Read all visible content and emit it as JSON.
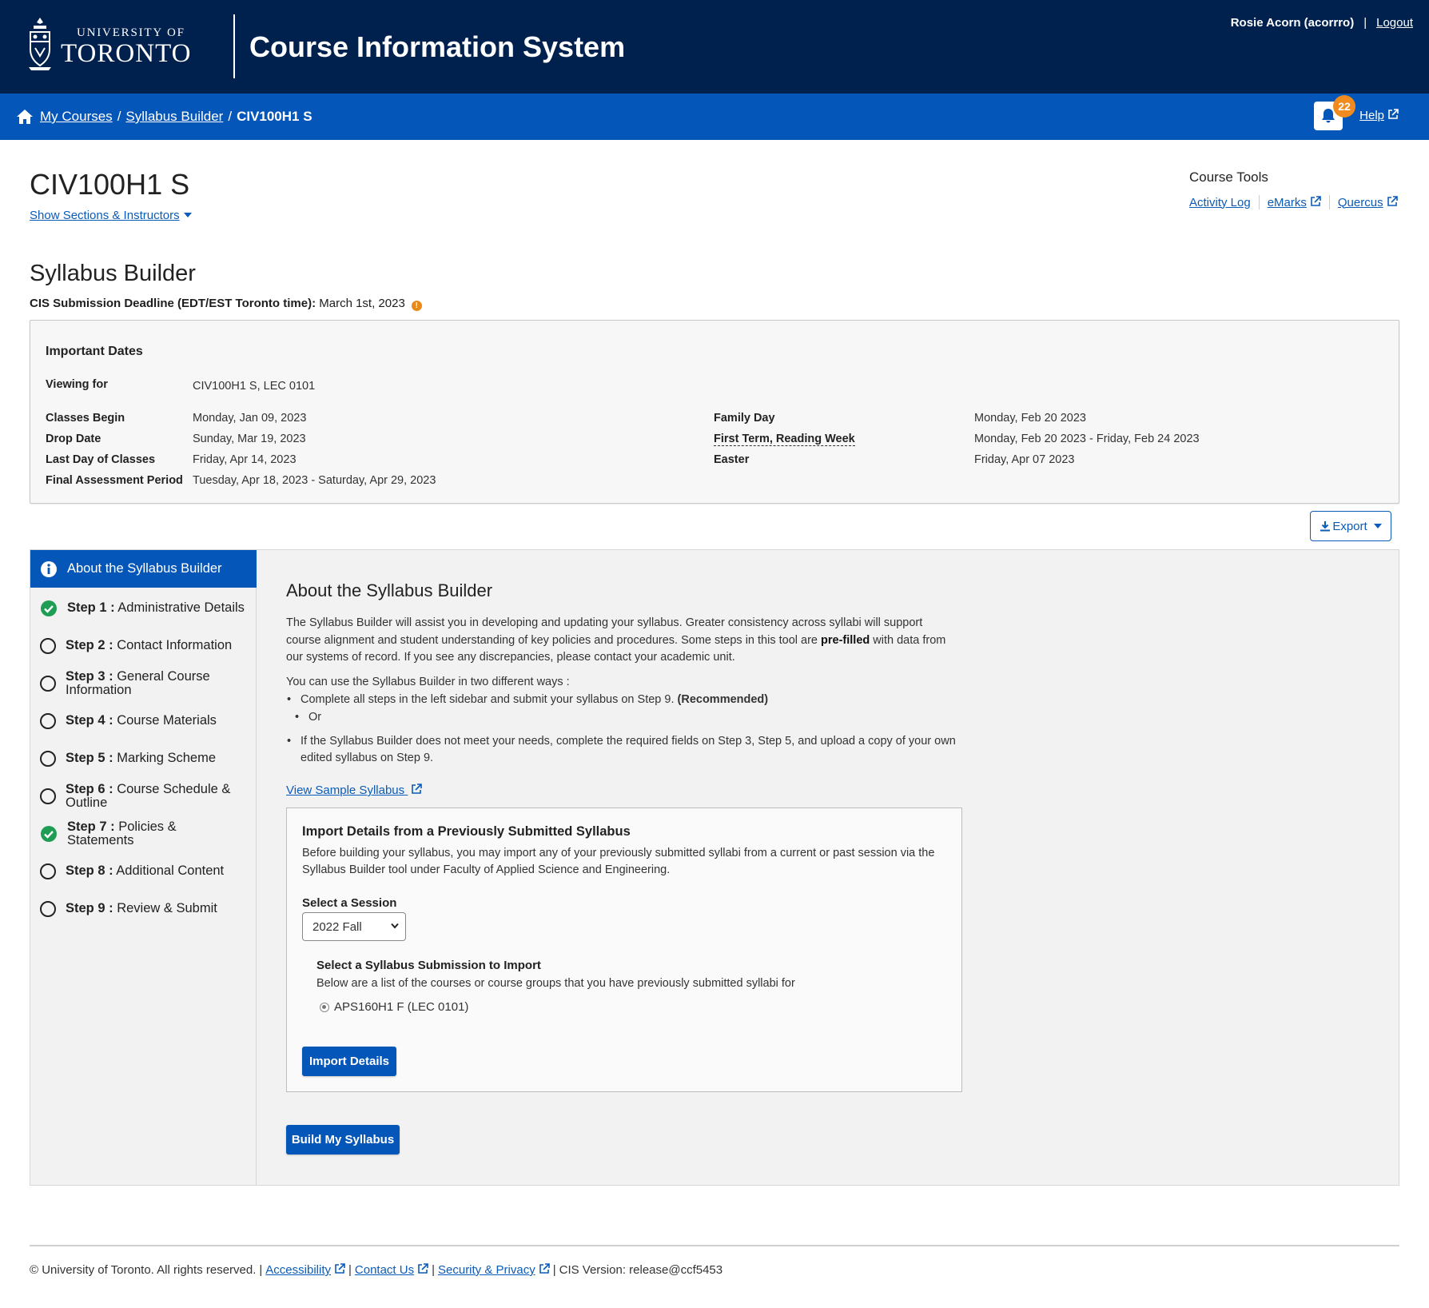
{
  "header": {
    "logo_university_of": "UNIVERSITY OF",
    "logo_toronto": "TORONTO",
    "app_title": "Course Information System",
    "user": "Rosie Acorn (acorrro)",
    "logout": "Logout"
  },
  "nav": {
    "breadcrumbs": [
      "My Courses",
      "Syllabus Builder",
      "CIV100H1 S"
    ],
    "notification_count": "22",
    "help": "Help"
  },
  "course": {
    "code": "CIV100H1 S",
    "show_sections": "Show Sections & Instructors"
  },
  "course_tools": {
    "title": "Course Tools",
    "links": [
      "Activity Log",
      "eMarks",
      "Quercus"
    ]
  },
  "syllabus_builder": {
    "title": "Syllabus Builder",
    "deadline_label": "CIS Submission Deadline (EDT/EST Toronto time):",
    "deadline_value": "March 1st, 2023"
  },
  "important_dates": {
    "title": "Important Dates",
    "viewing_for_label": "Viewing for",
    "viewing_for_value": "CIV100H1 S, LEC 0101",
    "left": [
      {
        "label": "Classes Begin",
        "value": "Monday, Jan 09, 2023"
      },
      {
        "label": "Drop Date",
        "value": "Sunday, Mar 19, 2023"
      },
      {
        "label": "Last Day of Classes",
        "value": "Friday, Apr 14, 2023"
      },
      {
        "label": "Final Assessment Period",
        "value": "Tuesday, Apr 18, 2023 - Saturday, Apr 29, 2023"
      }
    ],
    "right": [
      {
        "label": "Family Day",
        "value": "Monday, Feb 20 2023"
      },
      {
        "label": "First Term, Reading Week",
        "value": "Monday, Feb 20 2023 - Friday, Feb 24 2023"
      },
      {
        "label": "Easter",
        "value": "Friday, Apr 07 2023"
      }
    ]
  },
  "export_label": "Export",
  "steps": [
    {
      "num": "",
      "title": "About the Syllabus Builder",
      "status": "active"
    },
    {
      "num": "Step 1 :",
      "title": "Administrative Details",
      "status": "complete"
    },
    {
      "num": "Step 2 :",
      "title": "Contact Information",
      "status": "incomplete"
    },
    {
      "num": "Step 3 :",
      "title": "General Course Information",
      "status": "incomplete"
    },
    {
      "num": "Step 4 :",
      "title": "Course Materials",
      "status": "incomplete"
    },
    {
      "num": "Step 5 :",
      "title": "Marking Scheme",
      "status": "incomplete"
    },
    {
      "num": "Step 6 :",
      "title": "Course Schedule & Outline",
      "status": "incomplete"
    },
    {
      "num": "Step 7 :",
      "title": "Policies & Statements",
      "status": "complete"
    },
    {
      "num": "Step 8 :",
      "title": "Additional Content",
      "status": "incomplete"
    },
    {
      "num": "Step 9 :",
      "title": "Review & Submit",
      "status": "incomplete"
    }
  ],
  "about": {
    "title": "About the Syllabus Builder",
    "intro_1": "The Syllabus Builder will assist you in developing and updating your syllabus. Greater consistency across syllabi will support course alignment and student understanding of key policies and procedures. Some steps in this tool are",
    "intro_bold": "pre-filled",
    "intro_2": "with data from our systems of record. If you see any discrepancies, please contact your academic unit.",
    "ways_intro": "You can use the Syllabus Builder in two different ways :",
    "way_1": "Complete all steps in the left sidebar and submit your syllabus on Step 9.",
    "way_1_bold": "(Recommended)",
    "or": "Or",
    "way_2": "If the Syllabus Builder does not meet your needs, complete the required fields on Step 3, Step 5, and upload a copy of your own edited syllabus on Step 9.",
    "sample_link": "View Sample Syllabus"
  },
  "import": {
    "title": "Import Details from a Previously Submitted Syllabus",
    "desc": "Before building your syllabus, you may import any of your previously submitted syllabi from a current or past session via the Syllabus Builder tool under Faculty of Applied Science and Engineering.",
    "session_label": "Select a Session",
    "session_value": "2022 Fall",
    "submission_label": "Select a Syllabus Submission to Import",
    "submission_desc": "Below are a list of the courses or course groups that you have previously submitted syllabi for",
    "option": "APS160H1 F (LEC 0101)",
    "import_button": "Import Details"
  },
  "build_button": "Build My Syllabus",
  "footer": {
    "copyright": "© University of Toronto. All rights reserved.",
    "links": [
      "Accessibility",
      "Contact Us",
      "Security & Privacy"
    ],
    "version": "CIS Version: release@ccf5453"
  },
  "colors": {
    "header_bg": "#00204e",
    "nav_bg": "#0556b9",
    "badge": "#f28b1f",
    "complete": "#1f9d55"
  }
}
